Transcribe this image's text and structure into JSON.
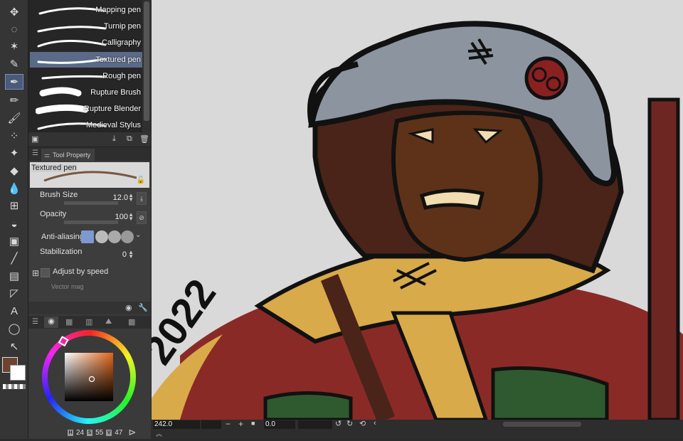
{
  "brushes": [
    {
      "label": "Mapping pen"
    },
    {
      "label": "Turnip pen"
    },
    {
      "label": "Calligraphy"
    },
    {
      "label": "Textured pen"
    },
    {
      "label": "Rough pen"
    },
    {
      "label": "Rupture Brush"
    },
    {
      "label": "Rupture Blender"
    },
    {
      "label": "Medieval Stylus"
    }
  ],
  "selected_brush_index": 3,
  "tool_property": {
    "tab_label": "Tool Property",
    "preset_name": "Textured pen",
    "brush_size_label": "Brush Size",
    "brush_size_value": "12.0",
    "opacity_label": "Opacity",
    "opacity_value": "100",
    "antialiasing_label": "Anti-aliasing",
    "stabilization_label": "Stabilization",
    "stabilization_value": "0",
    "adjust_speed_label": "Adjust by speed",
    "vector_label": "Vector mag"
  },
  "color": {
    "main": "#6b4330",
    "sub": "#ffffff",
    "h_label": "H",
    "h": "24",
    "s_label": "S",
    "s": "55",
    "v_label": "V",
    "v": "47"
  },
  "status": {
    "zoom": "242.0",
    "angle": "0.0"
  },
  "tools": [
    "move-icon",
    "lasso-icon",
    "magic-wand-icon",
    "eyedropper-icon",
    "pen-icon",
    "pencil-icon",
    "brush-icon",
    "airbrush-icon",
    "decoration-icon",
    "eraser-icon",
    "blend-icon",
    "mesh-icon",
    "fill-icon",
    "gradient-icon",
    "line-icon",
    "frame-icon",
    "ruler-icon",
    "text-icon",
    "balloon-icon",
    "correction-icon"
  ],
  "signature": "2022"
}
